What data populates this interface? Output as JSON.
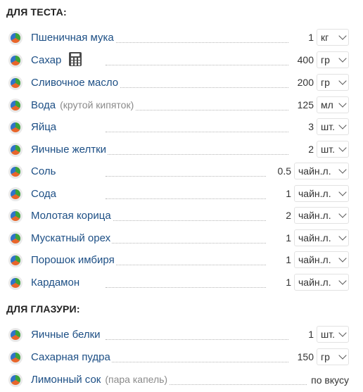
{
  "sections": [
    {
      "title": "ДЛЯ ТЕСТА:",
      "items": [
        {
          "name": "Пшеничная мука",
          "qty": "1",
          "unit": "кг"
        },
        {
          "name": "Сахар",
          "qty": "400",
          "unit": "гр",
          "calculator": true
        },
        {
          "name": "Сливочное масло",
          "qty": "200",
          "unit": "гр"
        },
        {
          "name": "Вода",
          "note": "(крутой кипяток)",
          "qty": "125",
          "unit": "мл"
        },
        {
          "name": "Яйца",
          "qty": "3",
          "unit": "шт."
        },
        {
          "name": "Яичные желтки",
          "qty": "2",
          "unit": "шт."
        },
        {
          "name": "Соль",
          "qty": "0.5",
          "unit": "чайн.л."
        },
        {
          "name": "Сода",
          "qty": "1",
          "unit": "чайн.л."
        },
        {
          "name": "Молотая корица",
          "qty": "2",
          "unit": "чайн.л."
        },
        {
          "name": "Мускатный орех",
          "qty": "1",
          "unit": "чайн.л."
        },
        {
          "name": "Порошок имбиря",
          "qty": "1",
          "unit": "чайн.л."
        },
        {
          "name": "Кардамон",
          "qty": "1",
          "unit": "чайн.л."
        }
      ]
    },
    {
      "title": "ДЛЯ ГЛАЗУРИ:",
      "items": [
        {
          "name": "Яичные белки",
          "qty": "1",
          "unit": "шт."
        },
        {
          "name": "Сахарная пудра",
          "qty": "150",
          "unit": "гр"
        },
        {
          "name": "Лимонный сок",
          "note": "(пара капель)",
          "to_taste": "по вкусу"
        }
      ]
    }
  ],
  "icons": {
    "nutrition": "pie-chart-icon",
    "calculator": "calculator-icon",
    "dropdown": "chevron-down-icon"
  },
  "colors": {
    "ingredient_link": "#1d4f85",
    "note": "#8a8a8a",
    "pie_green": "#3aa33a",
    "pie_orange": "#e8652a",
    "pie_blue": "#2f73c8"
  }
}
